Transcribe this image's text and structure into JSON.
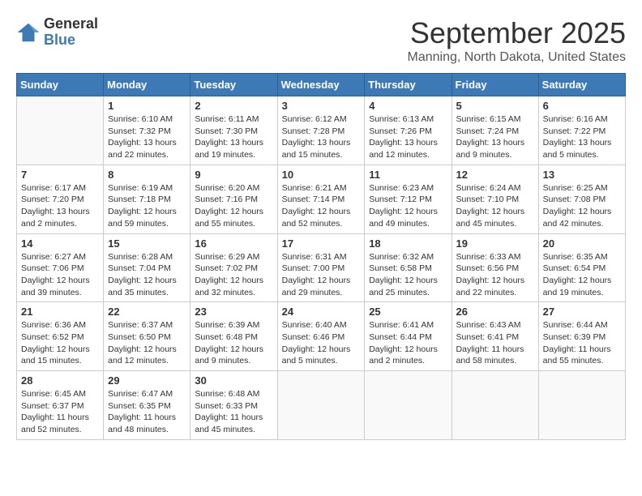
{
  "header": {
    "logo_general": "General",
    "logo_blue": "Blue",
    "month_title": "September 2025",
    "location": "Manning, North Dakota, United States"
  },
  "days_of_week": [
    "Sunday",
    "Monday",
    "Tuesday",
    "Wednesday",
    "Thursday",
    "Friday",
    "Saturday"
  ],
  "weeks": [
    [
      {
        "day": "",
        "info": ""
      },
      {
        "day": "1",
        "info": "Sunrise: 6:10 AM\nSunset: 7:32 PM\nDaylight: 13 hours\nand 22 minutes."
      },
      {
        "day": "2",
        "info": "Sunrise: 6:11 AM\nSunset: 7:30 PM\nDaylight: 13 hours\nand 19 minutes."
      },
      {
        "day": "3",
        "info": "Sunrise: 6:12 AM\nSunset: 7:28 PM\nDaylight: 13 hours\nand 15 minutes."
      },
      {
        "day": "4",
        "info": "Sunrise: 6:13 AM\nSunset: 7:26 PM\nDaylight: 13 hours\nand 12 minutes."
      },
      {
        "day": "5",
        "info": "Sunrise: 6:15 AM\nSunset: 7:24 PM\nDaylight: 13 hours\nand 9 minutes."
      },
      {
        "day": "6",
        "info": "Sunrise: 6:16 AM\nSunset: 7:22 PM\nDaylight: 13 hours\nand 5 minutes."
      }
    ],
    [
      {
        "day": "7",
        "info": "Sunrise: 6:17 AM\nSunset: 7:20 PM\nDaylight: 13 hours\nand 2 minutes."
      },
      {
        "day": "8",
        "info": "Sunrise: 6:19 AM\nSunset: 7:18 PM\nDaylight: 12 hours\nand 59 minutes."
      },
      {
        "day": "9",
        "info": "Sunrise: 6:20 AM\nSunset: 7:16 PM\nDaylight: 12 hours\nand 55 minutes."
      },
      {
        "day": "10",
        "info": "Sunrise: 6:21 AM\nSunset: 7:14 PM\nDaylight: 12 hours\nand 52 minutes."
      },
      {
        "day": "11",
        "info": "Sunrise: 6:23 AM\nSunset: 7:12 PM\nDaylight: 12 hours\nand 49 minutes."
      },
      {
        "day": "12",
        "info": "Sunrise: 6:24 AM\nSunset: 7:10 PM\nDaylight: 12 hours\nand 45 minutes."
      },
      {
        "day": "13",
        "info": "Sunrise: 6:25 AM\nSunset: 7:08 PM\nDaylight: 12 hours\nand 42 minutes."
      }
    ],
    [
      {
        "day": "14",
        "info": "Sunrise: 6:27 AM\nSunset: 7:06 PM\nDaylight: 12 hours\nand 39 minutes."
      },
      {
        "day": "15",
        "info": "Sunrise: 6:28 AM\nSunset: 7:04 PM\nDaylight: 12 hours\nand 35 minutes."
      },
      {
        "day": "16",
        "info": "Sunrise: 6:29 AM\nSunset: 7:02 PM\nDaylight: 12 hours\nand 32 minutes."
      },
      {
        "day": "17",
        "info": "Sunrise: 6:31 AM\nSunset: 7:00 PM\nDaylight: 12 hours\nand 29 minutes."
      },
      {
        "day": "18",
        "info": "Sunrise: 6:32 AM\nSunset: 6:58 PM\nDaylight: 12 hours\nand 25 minutes."
      },
      {
        "day": "19",
        "info": "Sunrise: 6:33 AM\nSunset: 6:56 PM\nDaylight: 12 hours\nand 22 minutes."
      },
      {
        "day": "20",
        "info": "Sunrise: 6:35 AM\nSunset: 6:54 PM\nDaylight: 12 hours\nand 19 minutes."
      }
    ],
    [
      {
        "day": "21",
        "info": "Sunrise: 6:36 AM\nSunset: 6:52 PM\nDaylight: 12 hours\nand 15 minutes."
      },
      {
        "day": "22",
        "info": "Sunrise: 6:37 AM\nSunset: 6:50 PM\nDaylight: 12 hours\nand 12 minutes."
      },
      {
        "day": "23",
        "info": "Sunrise: 6:39 AM\nSunset: 6:48 PM\nDaylight: 12 hours\nand 9 minutes."
      },
      {
        "day": "24",
        "info": "Sunrise: 6:40 AM\nSunset: 6:46 PM\nDaylight: 12 hours\nand 5 minutes."
      },
      {
        "day": "25",
        "info": "Sunrise: 6:41 AM\nSunset: 6:44 PM\nDaylight: 12 hours\nand 2 minutes."
      },
      {
        "day": "26",
        "info": "Sunrise: 6:43 AM\nSunset: 6:41 PM\nDaylight: 11 hours\nand 58 minutes."
      },
      {
        "day": "27",
        "info": "Sunrise: 6:44 AM\nSunset: 6:39 PM\nDaylight: 11 hours\nand 55 minutes."
      }
    ],
    [
      {
        "day": "28",
        "info": "Sunrise: 6:45 AM\nSunset: 6:37 PM\nDaylight: 11 hours\nand 52 minutes."
      },
      {
        "day": "29",
        "info": "Sunrise: 6:47 AM\nSunset: 6:35 PM\nDaylight: 11 hours\nand 48 minutes."
      },
      {
        "day": "30",
        "info": "Sunrise: 6:48 AM\nSunset: 6:33 PM\nDaylight: 11 hours\nand 45 minutes."
      },
      {
        "day": "",
        "info": ""
      },
      {
        "day": "",
        "info": ""
      },
      {
        "day": "",
        "info": ""
      },
      {
        "day": "",
        "info": ""
      }
    ]
  ]
}
